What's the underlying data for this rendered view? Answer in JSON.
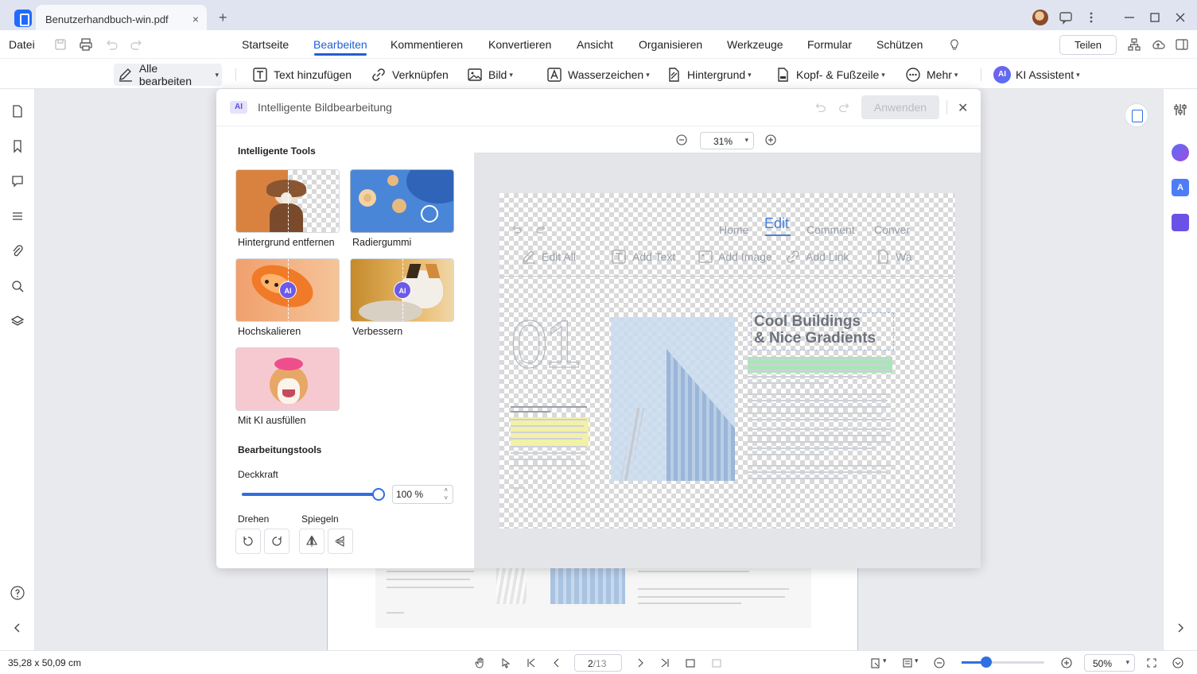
{
  "titlebar": {
    "tab_title": "Benutzerhandbuch-win.pdf",
    "close_glyph": "×",
    "new_tab_glyph": "+"
  },
  "menu": {
    "file": "Datei",
    "items": [
      "Startseite",
      "Bearbeiten",
      "Kommentieren",
      "Konvertieren",
      "Ansicht",
      "Organisieren",
      "Werkzeuge",
      "Formular",
      "Schützen"
    ],
    "active": "Bearbeiten",
    "share": "Teilen"
  },
  "toolbar": {
    "edit_all": "Alle bearbeiten",
    "add_text": "Text hinzufügen",
    "link": "Verknüpfen",
    "image": "Bild",
    "watermark": "Wasserzeichen",
    "background": "Hintergrund",
    "header_footer": "Kopf- & Fußzeile",
    "more": "Mehr",
    "ai_assistant": "KI Assistent"
  },
  "dialog": {
    "badge": "AI",
    "title": "Intelligente Bildbearbeitung",
    "apply": "Anwenden",
    "close_glyph": "✕",
    "smart_tools_title": "Intelligente Tools",
    "tools": [
      {
        "label": "Hintergrund entfernen",
        "icon": "remove-background"
      },
      {
        "label": "Radiergummi",
        "icon": "eraser"
      },
      {
        "label": "Hochskalieren",
        "icon": "upscale",
        "badge": "AI"
      },
      {
        "label": "Verbessern",
        "icon": "enhance",
        "badge": "AI"
      },
      {
        "label": "Mit KI ausfüllen",
        "icon": "ai-fill"
      }
    ],
    "edit_tools_title": "Bearbeitungstools",
    "opacity_label": "Deckkraft",
    "opacity_value": "100 %",
    "opacity_fraction": 1.0,
    "rotate_label": "Drehen",
    "mirror_label": "Spiegeln",
    "zoom": "31%"
  },
  "preview": {
    "menu": [
      "Home",
      "Edit",
      "Comment",
      "Conver"
    ],
    "active": "Edit",
    "tools": [
      "Edit All",
      "Add Text",
      "Add Image",
      "Add Link",
      "Wa"
    ],
    "heading_line1": "Cool Buildings",
    "heading_line2": "& Nice Gradients",
    "big_number": "01"
  },
  "status": {
    "dimensions": "35,28 x 50,09 cm",
    "page_current": "2",
    "page_total": "/13",
    "zoom": "50%"
  },
  "colors": {
    "accent": "#1f5fd6",
    "ai_purple": "#6d5ae8",
    "slider": "#2f6fe0"
  }
}
